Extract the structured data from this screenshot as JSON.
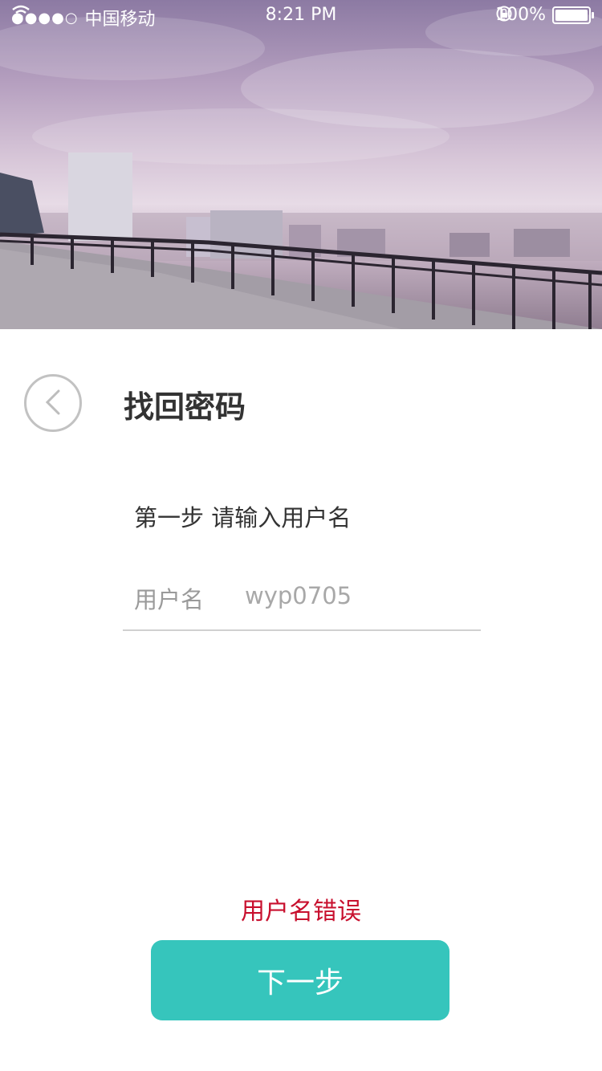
{
  "status_bar": {
    "signal_dots": "●●●●○",
    "carrier": "中国移动",
    "time": "8:21 PM",
    "battery_percent": "100%",
    "battery_level": 1.0
  },
  "header": {
    "title": "找回密码"
  },
  "form": {
    "step_text": "第一步 请输入用户名",
    "username_label": "用户名",
    "username_value": "wyp0705"
  },
  "error_text": "用户名错误",
  "next_button_label": "下一步",
  "colors": {
    "primary": "#36c5bc",
    "error": "#c8102e"
  }
}
